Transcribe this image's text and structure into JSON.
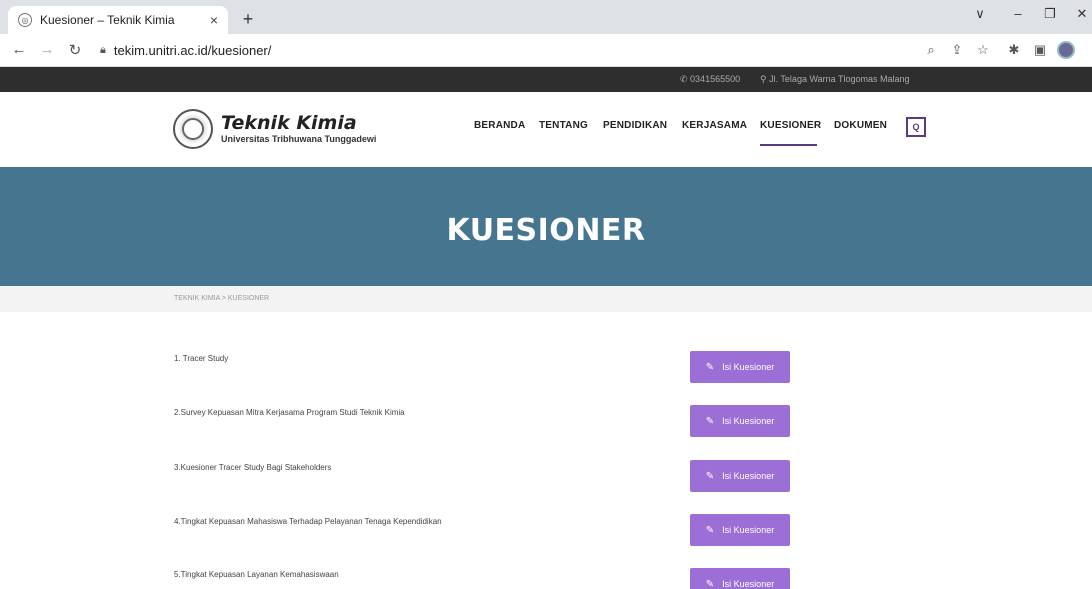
{
  "browser": {
    "tab_title": "Kuesioner – Teknik Kimia",
    "tab_close": "×",
    "new_tab": "+",
    "url": "tekim.unitri.ac.id/kuesioner/",
    "controls": {
      "minimize": "–",
      "restore": "❐",
      "close": "✕",
      "dropdown": "∨"
    }
  },
  "topinfo": {
    "phone": "0341565500",
    "address": "Jl. Telaga Warna Tlogomas Malang"
  },
  "logo": {
    "name": "Teknik Kimia",
    "subtitle": "Universitas Tribhuwana Tunggadewi"
  },
  "menu": [
    {
      "label": "BERANDA"
    },
    {
      "label": "TENTANG"
    },
    {
      "label": "PENDIDIKAN"
    },
    {
      "label": "KERJASAMA"
    },
    {
      "label": "KUESIONER",
      "active": true
    },
    {
      "label": "DOKUMEN"
    }
  ],
  "banner": {
    "title": "KUESIONER"
  },
  "breadcrumb": "TEKNIK KIMIA > KUESIONER",
  "questionnaires": [
    {
      "label": "1. Tracer Study",
      "button": "Isi Kuesioner"
    },
    {
      "label": "2.Survey Kepuasan Mitra Kerjasama Program Studi Teknik Kimia",
      "button": "Isi Kuesioner"
    },
    {
      "label": "3.Kuesioner Tracer Study Bagi Stakeholders",
      "button": "Isi Kuesioner"
    },
    {
      "label": "4.Tingkat Kepuasan Mahasiswa Terhadap Pelayanan Tenaga Kependidikan",
      "button": "Isi Kuesioner"
    },
    {
      "label": "5.Tingkat Kepuasan Layanan Kemahasiswaan",
      "button": "Isi Kuesioner"
    }
  ],
  "colors": {
    "banner": "#45758f",
    "button": "#9b6fd6",
    "accent": "#5b3a85"
  }
}
